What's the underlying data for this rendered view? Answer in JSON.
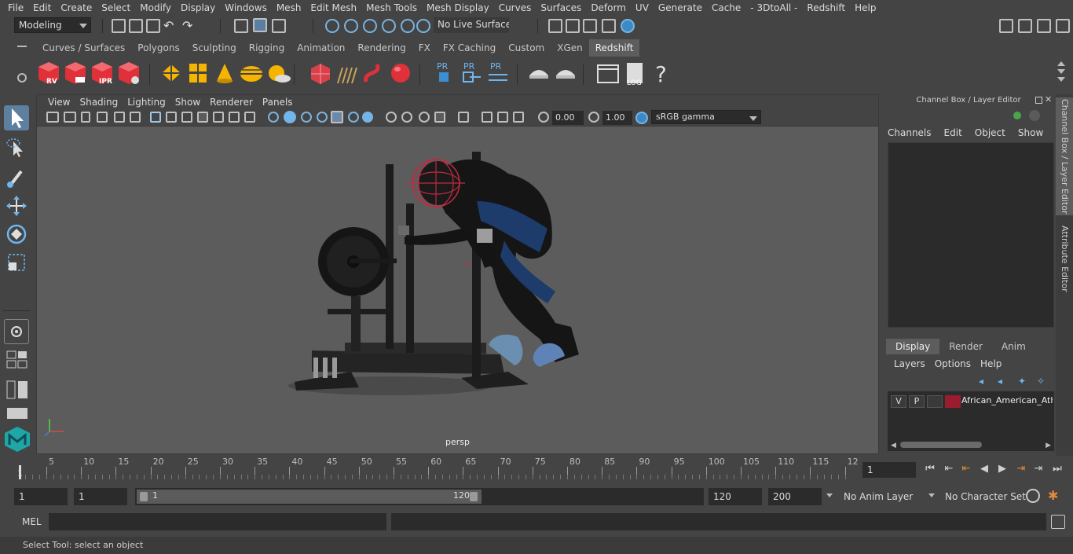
{
  "menubar": [
    "File",
    "Edit",
    "Create",
    "Select",
    "Modify",
    "Display",
    "Windows",
    "Mesh",
    "Edit Mesh",
    "Mesh Tools",
    "Mesh Display",
    "Curves",
    "Surfaces",
    "Deform",
    "UV",
    "Generate",
    "Cache",
    "- 3DtoAll -",
    "Redshift",
    "Help"
  ],
  "statusline": {
    "mode": "Modeling",
    "live_surface": "No Live Surface"
  },
  "shelf": {
    "tabs": [
      "Curves / Surfaces",
      "Polygons",
      "Sculpting",
      "Rigging",
      "Animation",
      "Rendering",
      "FX",
      "FX Caching",
      "Custom",
      "XGen",
      "Redshift"
    ],
    "active_tab": "Redshift",
    "icons": {
      "rv": "RV",
      "ipr": "IPR",
      "pr1": "PR",
      "pr2": "PR",
      "pr3": "PR",
      "log": "LOG",
      "help": "?"
    }
  },
  "viewport": {
    "menu": [
      "View",
      "Shading",
      "Lighting",
      "Show",
      "Renderer",
      "Panels"
    ],
    "exposure": "0.00",
    "gamma": "1.00",
    "color_space": "sRGB gamma",
    "camera_label": "persp"
  },
  "channel_box": {
    "title": "Channel Box / Layer Editor",
    "menu": [
      "Channels",
      "Edit",
      "Object",
      "Show"
    ],
    "layer_tabs": [
      "Display",
      "Render",
      "Anim"
    ],
    "active_layer_tab": "Display",
    "layer_menu": [
      "Layers",
      "Options",
      "Help"
    ],
    "layer": {
      "v": "V",
      "p": "P",
      "name": "African_American_Athl",
      "color": "#9b1b2f"
    }
  },
  "side_tabs": [
    "Channel Box / Layer Editor",
    "Attribute Editor"
  ],
  "timeline": {
    "ticks": [
      "5",
      "10",
      "15",
      "20",
      "25",
      "30",
      "35",
      "40",
      "45",
      "50",
      "55",
      "60",
      "65",
      "70",
      "75",
      "80",
      "85",
      "90",
      "95",
      "100",
      "105",
      "110",
      "115",
      "12"
    ],
    "start_marker": "1",
    "current_frame": "1"
  },
  "range": {
    "start": "1",
    "playback_start": "1",
    "slider_start": "1",
    "slider_end": "120",
    "playback_end": "120",
    "end": "200",
    "anim_layer": "No Anim Layer",
    "character_set": "No Character Set"
  },
  "command": {
    "label": "MEL"
  },
  "help_line": "Select Tool: select an object"
}
